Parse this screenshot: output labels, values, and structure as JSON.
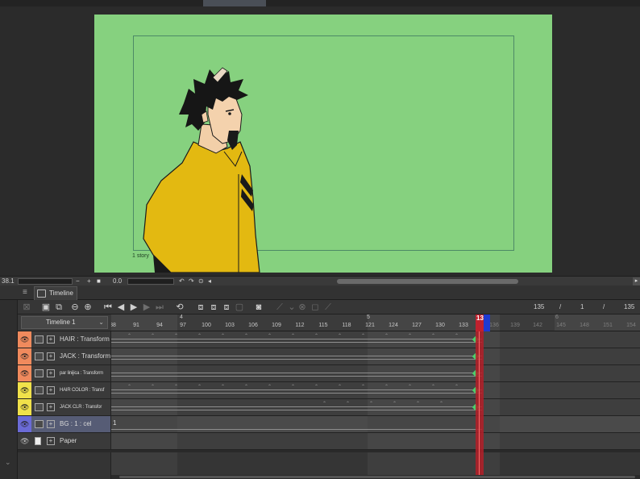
{
  "canvas": {
    "background_color": "#86d17f",
    "frame_label": "1 story"
  },
  "status_bar": {
    "zoom": "38.1",
    "minus": "−",
    "plus": "+",
    "angle": "0.0"
  },
  "panel": {
    "tab_label": "Timeline"
  },
  "toolbar": {
    "current_frame": "135",
    "slash1": "/",
    "start_frame": "1",
    "slash2": "/",
    "end_frame": "135",
    "icons": [
      "new-timeline-icon",
      "timeline-settings-icon",
      "zoom-out-icon",
      "zoom-in-icon",
      "first-frame-icon",
      "prev-frame-icon",
      "play-icon",
      "next-frame-icon",
      "last-frame-icon",
      "loop-icon",
      "new-cel-icon",
      "assign-cel-icon",
      "specify-cel-icon",
      "delete-cel-icon",
      "onion-skin-icon",
      "keyframe-icon",
      "keyframe-interp-icon",
      "ease-icon",
      "clear-keyframe-icon"
    ]
  },
  "timeline": {
    "name": "Timeline 1",
    "seconds": [
      {
        "label": "4",
        "frame": 97
      },
      {
        "label": "5",
        "frame": 121
      },
      {
        "label": "6",
        "frame": 145
      }
    ],
    "frame_labels": [
      "88",
      "91",
      "94",
      "97",
      "100",
      "103",
      "106",
      "109",
      "112",
      "115",
      "118",
      "121",
      "124",
      "127",
      "130",
      "133",
      "135",
      "136",
      "139",
      "142",
      "145",
      "148",
      "151",
      "154"
    ],
    "current_frame": "135",
    "accent_playhead": "#c0212e",
    "accent_end": "#1e3ad1"
  },
  "layers": [
    {
      "name": "HAIR : Transform",
      "color": "#f08a5d",
      "small": false,
      "keyframes": true,
      "selected": false
    },
    {
      "name": "JACK : Transform",
      "color": "#f08a5d",
      "small": false,
      "keyframes": true,
      "selected": false
    },
    {
      "name": "par linijica : Transform",
      "color": "#f08a5d",
      "small": true,
      "keyframes": true,
      "selected": false
    },
    {
      "name": "HAIR COLOR : Transf",
      "color": "#f0e14a",
      "small": true,
      "keyframes": true,
      "selected": false
    },
    {
      "name": "JACK CLR : Transfor",
      "color": "#f0e14a",
      "small": true,
      "keyframes": true,
      "selected": false
    },
    {
      "name": "BG : 1 : cel",
      "color": "#6b6bd6",
      "small": false,
      "keyframes": false,
      "cel": "1",
      "selected": true
    },
    {
      "name": "Paper",
      "color": "#3a3a3a",
      "small": false,
      "keyframes": false,
      "selected": false
    }
  ]
}
